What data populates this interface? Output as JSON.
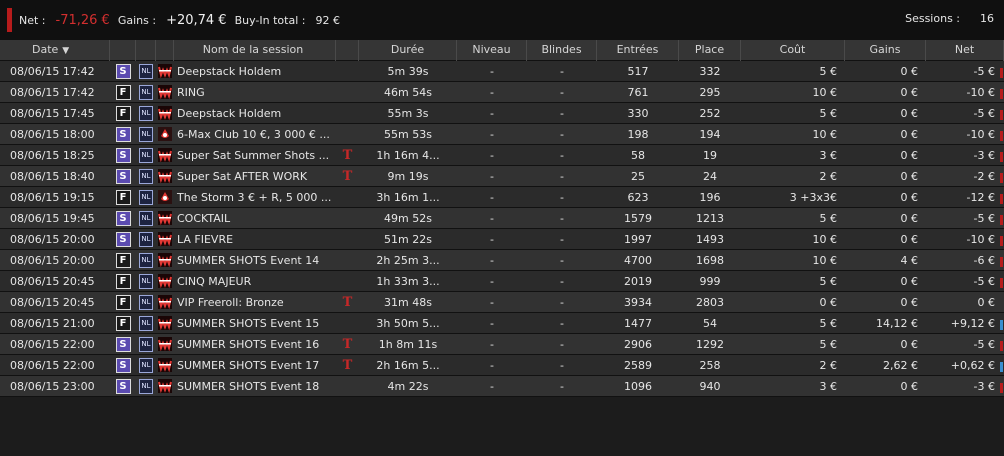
{
  "summary": {
    "net_label": "Net :",
    "net_value": "-71,26 €",
    "gains_label": "Gains :",
    "gains_value": "+20,74 €",
    "buyin_label": "Buy-In total :",
    "buyin_value": "92 €",
    "sessions_label": "Sessions :",
    "sessions_value": "16"
  },
  "columns": {
    "date": "Date",
    "name": "Nom de la session",
    "duration": "Durée",
    "level": "Niveau",
    "blinds": "Blindes",
    "entries": "Entrées",
    "place": "Place",
    "cost": "Coût",
    "gains": "Gains",
    "net": "Net"
  },
  "colors": {
    "loss": "#b71c1c",
    "win": "#3a8fd0",
    "type_S": "#5b4bb0",
    "type_F": "#1a1a1a"
  },
  "rows": [
    {
      "date": "08/06/15 17:42",
      "type": "S",
      "limit": "NL",
      "room": "winamax-icon",
      "name": "Deepstack Holdem",
      "flag": "",
      "duration": "5m 39s",
      "level": "-",
      "blinds": "-",
      "entries": "517",
      "place": "332",
      "cost": "5 €",
      "gains": "0 €",
      "net": "-5 €",
      "result": "loss"
    },
    {
      "date": "08/06/15 17:42",
      "type": "F",
      "limit": "NL",
      "room": "winamax-icon",
      "name": "RING",
      "flag": "",
      "duration": "46m 54s",
      "level": "-",
      "blinds": "-",
      "entries": "761",
      "place": "295",
      "cost": "10 €",
      "gains": "0 €",
      "net": "-10 €",
      "result": "loss"
    },
    {
      "date": "08/06/15 17:45",
      "type": "F",
      "limit": "NL",
      "room": "winamax-icon",
      "name": "Deepstack Holdem",
      "flag": "",
      "duration": "55m 3s",
      "level": "-",
      "blinds": "-",
      "entries": "330",
      "place": "252",
      "cost": "5 €",
      "gains": "0 €",
      "net": "-5 €",
      "result": "loss"
    },
    {
      "date": "08/06/15 18:00",
      "type": "S",
      "limit": "NL",
      "room": "pokerstars-icon",
      "name": "6-Max Club 10 €, 3 000 € ...",
      "flag": "",
      "duration": "55m 53s",
      "level": "-",
      "blinds": "-",
      "entries": "198",
      "place": "194",
      "cost": "10 €",
      "gains": "0 €",
      "net": "-10 €",
      "result": "loss"
    },
    {
      "date": "08/06/15 18:25",
      "type": "S",
      "limit": "NL",
      "room": "winamax-icon",
      "name": "Super Sat Summer Shots ...",
      "flag": "T",
      "duration": "1h 16m 4...",
      "level": "-",
      "blinds": "-",
      "entries": "58",
      "place": "19",
      "cost": "3 €",
      "gains": "0 €",
      "net": "-3 €",
      "result": "loss"
    },
    {
      "date": "08/06/15 18:40",
      "type": "S",
      "limit": "NL",
      "room": "winamax-icon",
      "name": "Super Sat AFTER WORK",
      "flag": "T",
      "duration": "9m 19s",
      "level": "-",
      "blinds": "-",
      "entries": "25",
      "place": "24",
      "cost": "2 €",
      "gains": "0 €",
      "net": "-2 €",
      "result": "loss"
    },
    {
      "date": "08/06/15 19:15",
      "type": "F",
      "limit": "NL",
      "room": "pokerstars-icon",
      "name": "The Storm 3 € + R, 5 000 ...",
      "flag": "",
      "duration": "3h 16m 1...",
      "level": "-",
      "blinds": "-",
      "entries": "623",
      "place": "196",
      "cost": "3   +3x3€",
      "gains": "0 €",
      "net": "-12 €",
      "result": "loss"
    },
    {
      "date": "08/06/15 19:45",
      "type": "S",
      "limit": "NL",
      "room": "winamax-icon",
      "name": "COCKTAIL",
      "flag": "",
      "duration": "49m 52s",
      "level": "-",
      "blinds": "-",
      "entries": "1579",
      "place": "1213",
      "cost": "5 €",
      "gains": "0 €",
      "net": "-5 €",
      "result": "loss"
    },
    {
      "date": "08/06/15 20:00",
      "type": "S",
      "limit": "NL",
      "room": "winamax-icon",
      "name": "LA FIEVRE",
      "flag": "",
      "duration": "51m 22s",
      "level": "-",
      "blinds": "-",
      "entries": "1997",
      "place": "1493",
      "cost": "10 €",
      "gains": "0 €",
      "net": "-10 €",
      "result": "loss"
    },
    {
      "date": "08/06/15 20:00",
      "type": "F",
      "limit": "NL",
      "room": "winamax-icon",
      "name": "SUMMER SHOTS Event 14",
      "flag": "",
      "duration": "2h 25m 3...",
      "level": "-",
      "blinds": "-",
      "entries": "4700",
      "place": "1698",
      "cost": "10 €",
      "gains": "4 €",
      "net": "-6 €",
      "result": "loss"
    },
    {
      "date": "08/06/15 20:45",
      "type": "F",
      "limit": "NL",
      "room": "winamax-icon",
      "name": "CINQ MAJEUR",
      "flag": "",
      "duration": "1h 33m 3...",
      "level": "-",
      "blinds": "-",
      "entries": "2019",
      "place": "999",
      "cost": "5 €",
      "gains": "0 €",
      "net": "-5 €",
      "result": "loss"
    },
    {
      "date": "08/06/15 20:45",
      "type": "F",
      "limit": "NL",
      "room": "winamax-icon",
      "name": "VIP Freeroll: Bronze",
      "flag": "T",
      "duration": "31m 48s",
      "level": "-",
      "blinds": "-",
      "entries": "3934",
      "place": "2803",
      "cost": "0 €",
      "gains": "0 €",
      "net": "0 €",
      "result": "none"
    },
    {
      "date": "08/06/15 21:00",
      "type": "F",
      "limit": "NL",
      "room": "winamax-icon",
      "name": "SUMMER SHOTS Event 15",
      "flag": "",
      "duration": "3h 50m 5...",
      "level": "-",
      "blinds": "-",
      "entries": "1477",
      "place": "54",
      "cost": "5 €",
      "gains": "14,12 €",
      "net": "+9,12 €",
      "result": "win"
    },
    {
      "date": "08/06/15 22:00",
      "type": "S",
      "limit": "NL",
      "room": "winamax-icon",
      "name": "SUMMER SHOTS Event 16",
      "flag": "T",
      "duration": "1h 8m 11s",
      "level": "-",
      "blinds": "-",
      "entries": "2906",
      "place": "1292",
      "cost": "5 €",
      "gains": "0 €",
      "net": "-5 €",
      "result": "loss"
    },
    {
      "date": "08/06/15 22:00",
      "type": "S",
      "limit": "NL",
      "room": "winamax-icon",
      "name": "SUMMER SHOTS Event 17",
      "flag": "T",
      "duration": "2h 16m 5...",
      "level": "-",
      "blinds": "-",
      "entries": "2589",
      "place": "258",
      "cost": "2 €",
      "gains": "2,62 €",
      "net": "+0,62 €",
      "result": "win"
    },
    {
      "date": "08/06/15 23:00",
      "type": "S",
      "limit": "NL",
      "room": "winamax-icon",
      "name": "SUMMER SHOTS Event 18",
      "flag": "",
      "duration": "4m 22s",
      "level": "-",
      "blinds": "-",
      "entries": "1096",
      "place": "940",
      "cost": "3 €",
      "gains": "0 €",
      "net": "-3 €",
      "result": "loss"
    }
  ]
}
